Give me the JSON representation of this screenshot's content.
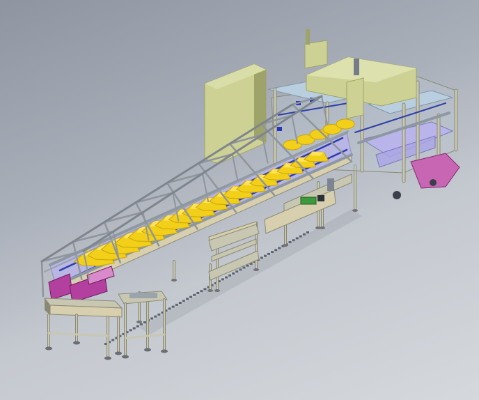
{
  "view": {
    "background": [
      "#8e95a1",
      "#d5d8dc"
    ]
  },
  "colors": {
    "frame": "#c8c7b1",
    "frame_dark": "#8a8a74",
    "rail": "#8d98a2",
    "chain_blue": "#2d3fa8",
    "part_yellow": "#f2cf18",
    "part_yellow_dark": "#c9a40c",
    "cabinet": "#cdd294",
    "cabinet_dark": "#9ea36a",
    "magenta": "#b3409e",
    "glass": "#b9cfe0",
    "lavender": "#b9b5ea",
    "tan_panel": "#d8cfae",
    "green": "#3c9a3c"
  },
  "components": {
    "conveyor_parts_count": 18,
    "rear_conveyor_parts_count": 5
  }
}
